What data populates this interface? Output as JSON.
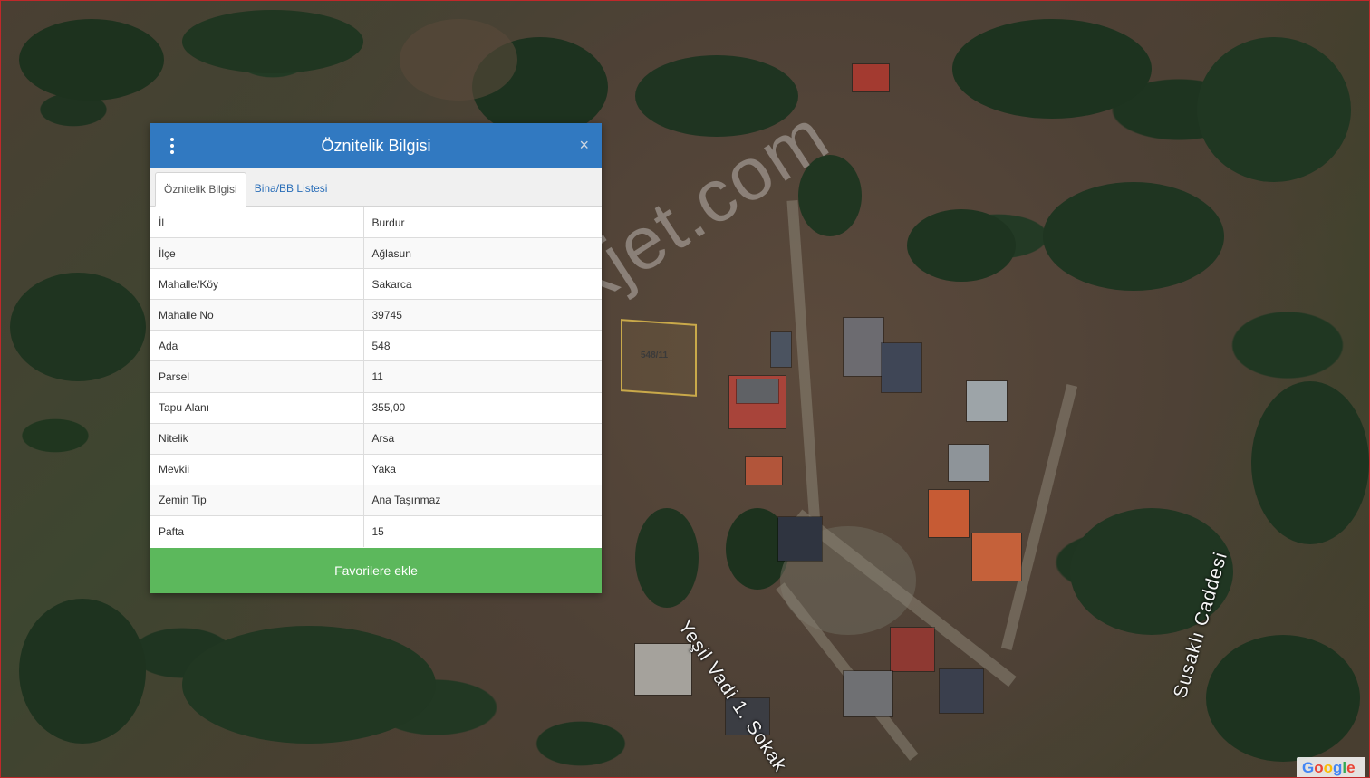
{
  "dialog": {
    "title": "Öznitelik Bilgisi",
    "menu_icon": "vertical-dots-icon",
    "close_glyph": "×",
    "tabs": [
      {
        "label": "Öznitelik Bilgisi",
        "active": true
      },
      {
        "label": "Bina/BB Listesi",
        "active": false
      }
    ],
    "rows": [
      {
        "key": "İl",
        "value": "Burdur"
      },
      {
        "key": "İlçe",
        "value": "Ağlasun"
      },
      {
        "key": "Mahalle/Köy",
        "value": "Sakarca"
      },
      {
        "key": "Mahalle No",
        "value": "39745"
      },
      {
        "key": "Ada",
        "value": "548"
      },
      {
        "key": "Parsel",
        "value": "11"
      },
      {
        "key": "Tapu Alanı",
        "value": "355,00"
      },
      {
        "key": "Nitelik",
        "value": "Arsa"
      },
      {
        "key": "Mevkii",
        "value": "Yaka"
      },
      {
        "key": "Zemin Tip",
        "value": "Ana Taşınmaz"
      },
      {
        "key": "Pafta",
        "value": "15"
      }
    ],
    "favorite_button": "Favorilere ekle"
  },
  "map": {
    "parcel_label": "548/11",
    "streets": [
      "Yeşil Vadi 1. Sokak",
      "Susaklı Caddesi"
    ],
    "watermark": "emlakjet.com",
    "attribution": "Google",
    "colors": {
      "header": "#3179c1",
      "favorite_button": "#5cb85c",
      "parcel_border": "#c9a94a"
    }
  }
}
